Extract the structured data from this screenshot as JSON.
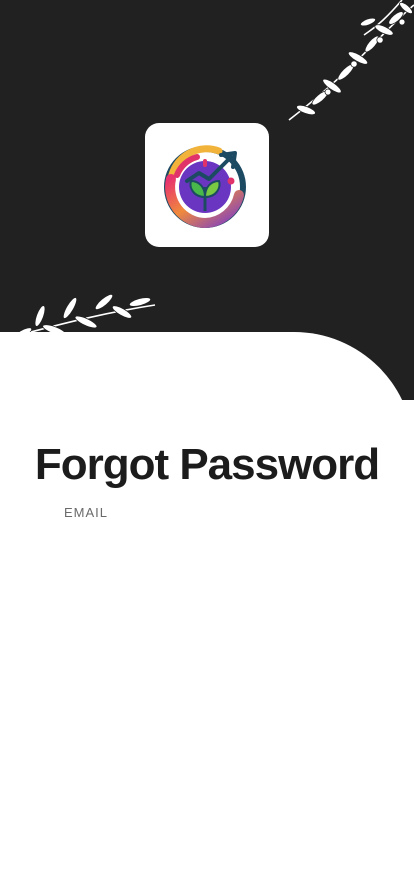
{
  "screen": {
    "title": "Forgot Password"
  },
  "form": {
    "email_label": "EMAIL",
    "email_value": "",
    "email_placeholder": ""
  },
  "colors": {
    "header_bg": "#202120",
    "sheet_bg": "#ffffff",
    "title_text": "#1c1c1c",
    "label_text": "#6a6a6a"
  },
  "icons": {
    "app_logo": "growth-plant-logo-icon",
    "decoration_top": "olive-branch-icon",
    "decoration_left": "olive-branch-icon"
  }
}
